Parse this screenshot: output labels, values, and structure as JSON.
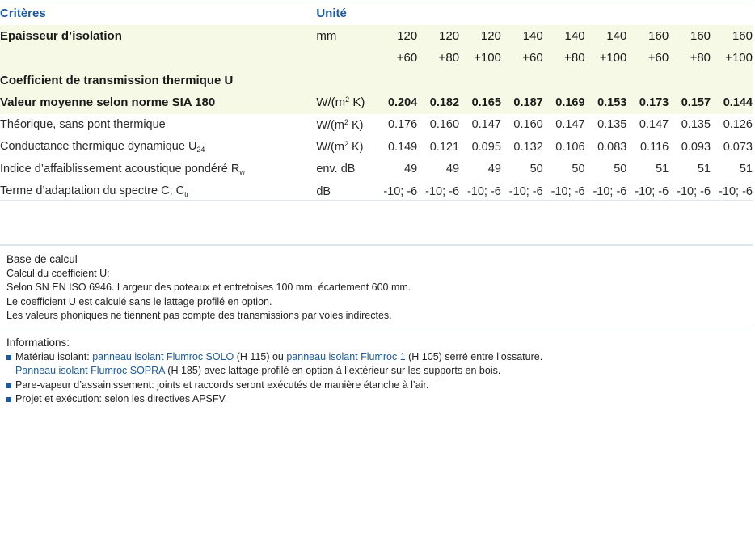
{
  "table": {
    "header": {
      "criteria": "Critères",
      "unit": "Unité"
    },
    "thickness": {
      "label": "Epaisseur d’isolation",
      "unit": "mm",
      "top": [
        "120",
        "120",
        "120",
        "140",
        "140",
        "140",
        "160",
        "160",
        "160"
      ],
      "bottom": [
        "+60",
        "+80",
        "+100",
        "+60",
        "+80",
        "+100",
        "+60",
        "+80",
        "+100"
      ]
    },
    "coef_title": "Coefficient de transmission thermique U",
    "mean": {
      "label": "Valeur moyenne selon norme SIA 180",
      "unit_main": "W/(m",
      "unit_sup": "2",
      "unit_end": " K)",
      "values": [
        "0.204",
        "0.182",
        "0.165",
        "0.187",
        "0.169",
        "0.153",
        "0.173",
        "0.157",
        "0.144"
      ]
    },
    "theoretical": {
      "label": "Théorique, sans pont thermique",
      "unit_main": "W/(m",
      "unit_sup": "2",
      "unit_end": " K)",
      "values": [
        "0.176",
        "0.160",
        "0.147",
        "0.160",
        "0.147",
        "0.135",
        "0.147",
        "0.135",
        "0.126"
      ]
    },
    "dynamic": {
      "label_main": "Conductance thermique dynamique U",
      "label_sub": "24",
      "unit_main": "W/(m",
      "unit_sup": "2",
      "unit_end": " K)",
      "values": [
        "0.149",
        "0.121",
        "0.095",
        "0.132",
        "0.106",
        "0.083",
        "0.116",
        "0.093",
        "0.073"
      ]
    },
    "acoustic": {
      "label_main": "Indice d’affaiblissement acoustique pondéré R",
      "label_sub": "w",
      "unit": "env. dB",
      "values": [
        "49",
        "49",
        "49",
        "50",
        "50",
        "50",
        "51",
        "51",
        "51"
      ]
    },
    "spectrum": {
      "label_main": "Terme d’adaptation du spectre C; C",
      "label_sub": "tr",
      "unit": "dB",
      "values": [
        "-10; -6",
        "-10; -6",
        "-10; -6",
        "-10; -6",
        "-10; -6",
        "-10; -6",
        "-10; -6",
        "-10; -6",
        "-10; -6"
      ]
    }
  },
  "base": {
    "title": "Base de calcul",
    "lines": [
      "Calcul du coefficient U:",
      "Selon SN EN ISO 6946. Largeur des poteaux et entretoises 100 mm, écartement 600 mm.",
      "Le coefficient U est calculé sans le lattage profilé en option.",
      "Les valeurs phoniques ne tiennent pas compte des transmissions par voies indirectes."
    ]
  },
  "info": {
    "title": "Informations:",
    "b1_a": "Matériau isolant: ",
    "b1_link1": "panneau isolant Flumroc SOLO",
    "b1_b": " (H 115) ou ",
    "b1_link2": "panneau isolant Flumroc 1",
    "b1_c": " (H 105) serré entre l’ossature.",
    "b1_link3": "Panneau isolant Flumroc SOPRA",
    "b1_d": " (H 185) avec lattage profilé en option à l’extérieur sur les supports en bois.",
    "b2": "Pare-vapeur d’assainissement: joints et raccords seront exécutés de manière étanche à l’air.",
    "b3": "Projet et exécution: selon les directives APSFV."
  },
  "colors": {
    "accent": "#1b5aa0",
    "row_shade": "#f6f9e6",
    "rule": "#dde6ec"
  }
}
